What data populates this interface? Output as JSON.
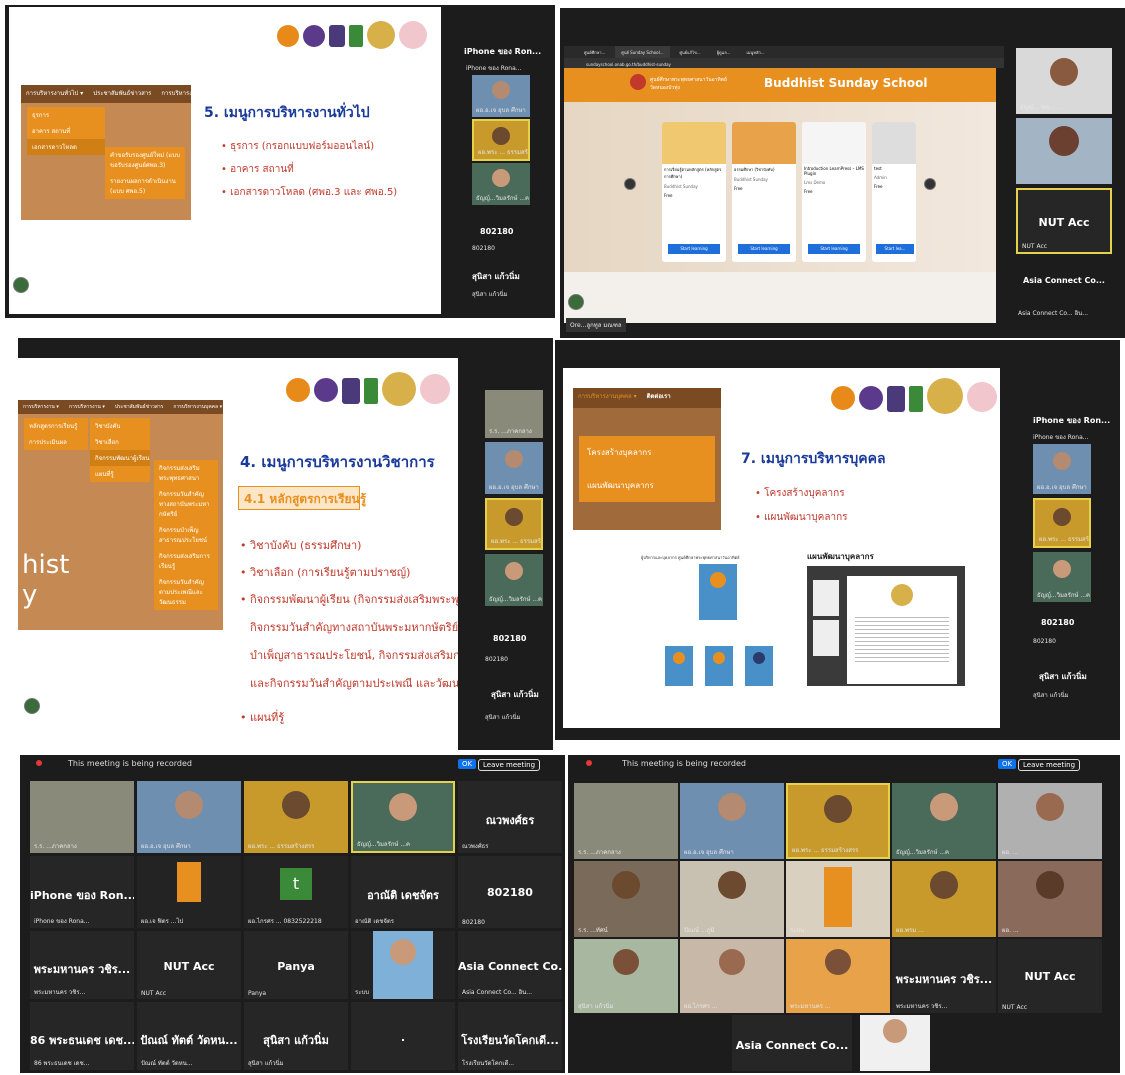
{
  "panel1": {
    "slide_title": "5. เมนูการบริหารงานทั่วไป",
    "bullets": [
      "ธุรการ (กรอกแบบฟอร์มออนไลน์)",
      "อาคาร สถานที่",
      "เอกสารดาวโหลด (ศพอ.3 และ ศพอ.5)"
    ],
    "menu_bar": [
      "การบริหารงานทั่วไป ▾",
      "ประชาสัมพันธ์ข่าวสาร",
      "การบริหารงานบุคคล ▾"
    ],
    "menu_items": [
      "ธุรการ",
      "อาคาร สถานที่",
      "เอกสารดาวโหลด"
    ],
    "submenu_items": [
      "คำขอรับรองศูนย์ใหม่ (แบบ ขอรับรองศูนย์ศพอ.3)",
      "รายงานผลการดำเนินงาน (แบบ ศพอ.5)"
    ],
    "sidebar_title": "iPhone ของ Ron...",
    "sidebar_sub": "iPhone ของ Rona...",
    "tiles": [
      "ผอ.อ.เจ อุบล ศึกษา",
      "ผอ.พระ ... ธรรมสร้างสรร",
      "ธัญญ์...วิมลรักษ์ ...ค"
    ],
    "bottom_names": [
      {
        "name": "802180",
        "sub": "802180"
      },
      {
        "name": "สุนิสา แก้วนิ่ม",
        "sub": "สุนิสา แก้วนิ่ม"
      }
    ]
  },
  "panel2": {
    "banner_title": "Buddhist Sunday School",
    "banner_org": "ศูนย์ศึกษาพระพุทธศาสนาวันอาทิตย์ วัดหนองบัวทุ่ง",
    "tabs": [
      "ศูนย์ศึกษา...",
      "ศูนย์ Sunday School...",
      "ศูนย์แก้ไข...",
      "ผู้ดูแล...",
      "เมนูหลัก..."
    ],
    "url": "sundayschool.onab.go.th/buddhist-sunday",
    "courses": [
      {
        "title": "การเรียนรู้ตามหลักสูตร (หลักสูตรการศึกษา)",
        "org": "Buddhist Sunday",
        "price": "Free",
        "button": "Start learning"
      },
      {
        "title": "ธรรมศึกษา (วิชาบังคับ)",
        "org": "Buddhist Sunday",
        "price": "Free",
        "button": "Start learning"
      },
      {
        "title": "Introduction LearnPress – LMS Plugin",
        "org": "Lms Demo",
        "price": "Free",
        "button": "Start learning"
      },
      {
        "title": "test",
        "org": "Admin",
        "price": "Free",
        "button": "Start lea..."
      }
    ],
    "sidebar_names": [
      "ธัญญ์... พลุ... ...",
      "NUT Acc",
      "Asia Connect Co..."
    ],
    "sidebar_subs": [
      "ธัญญ์... พลุ... ...",
      "NUT Acc",
      "Asia Connect Co... อิน..."
    ],
    "footer_label": "Ore...ลูกทูล มณฑล"
  },
  "panel3": {
    "slide_title": "4. เมนูการบริหารงานวิชาการ",
    "subtitle": "4.1 หลักสูตรการเรียนรู้",
    "bullets": [
      "วิชาบังคับ (ธรรมศึกษา)",
      "วิชาเลือก (การเรียนรู้ตามปราชญ์)",
      "กิจกรรมพัฒนาผู้เรียน (กิจกรรมส่งเสริมพระพุทธศาสนา,",
      "กิจกรรมวันสำคัญทางสถาบันพระมหากษัตริย์, กิจกรรม",
      "บำเพ็ญสาธารณประโยชน์, กิจกรรมส่งเสริมการเรียนรู้",
      "และกิจกรรมวันสำคัญตามประเพณี และวัฒนธรรม)",
      "แผนที่รู้"
    ],
    "menu_bar": [
      "การบริหารงาน ▾",
      "การบริหารงาน ▾",
      "ประชาสัมพันธ์ข่าวสาร",
      "การบริหารงานบุคคล ▾"
    ],
    "menu_col1": [
      "หลักสูตรการเรียนรู้",
      "การประเมินผล"
    ],
    "menu_col2": [
      "วิชาบังคับ",
      "วิชาเลือก",
      "กิจกรรมพัฒนาผู้เรียน",
      "แผนที่รู้"
    ],
    "menu_col3": [
      "กิจกรรมส่งเสริมพระพุทธศาสนา",
      "กิจกรรมวันสำคัญทางสถาบันพระมหากษัตริย์",
      "กิจกรรมบำเพ็ญสาธารณประโยชน์",
      "กิจกรรมส่งเสริมการเรียนรู้",
      "กิจกรรมวันสำคัญตามประเพณีและวัฒนธรรม"
    ],
    "bg_text": "hist\ny",
    "tiles": [
      "ร.ร. ...ภาคกลาง",
      "ผอ.อ.เจ อุบล ศึกษา",
      "ผอ.พระ ... ธรรมสร้างสรร",
      "ธัญญ์...วิมลรักษ์ ...ค"
    ],
    "bottom_names": [
      {
        "name": "802180",
        "sub": "802180"
      },
      {
        "name": "สุนิสา แก้วนิ่ม",
        "sub": "สุนิสา แก้วนิ่ม"
      }
    ]
  },
  "panel4": {
    "slide_title": "7. เมนูการบริหารบุคคล",
    "bullets": [
      "โครงสร้างบุคลากร",
      "แผนพัฒนาบุคลากร"
    ],
    "menu_bar": [
      "การบริหารงานบุคคล ▾",
      "ติดต่อเรา"
    ],
    "menu_items": [
      "โครงสร้างบุคลากร",
      "แผนพัฒนาบุคลากร"
    ],
    "section_label": "แผนพัฒนาบุคลากร",
    "org_caption": "ผู้บริหารและบุคลากร ศูนย์ศึกษาพระพุทธศาสนาวันอาทิตย์",
    "sidebar_title": "iPhone ของ Ron...",
    "sidebar_sub": "iPhone ของ Rona...",
    "tiles": [
      "ผอ.อ.เจ อุบล ศึกษา",
      "ผอ.พระ ... ธรรมสร้างสรร",
      "ธัญญ์...วิมลรักษ์ ...ค"
    ],
    "bottom_names": [
      {
        "name": "802180",
        "sub": "802180"
      },
      {
        "name": "สุนิสา แก้วนิ่ม",
        "sub": "สุนิสา แก้วนิ่ม"
      }
    ]
  },
  "panel5": {
    "recording_text": "This meeting is being recorded",
    "ok_label": "OK",
    "leave_label": "Leave meeting",
    "video_tiles": [
      "ร.ร. ...ภาคกลาง",
      "ผอ.อ.เจ อุบล ศึกษา",
      "ผอ.พระ ... ธรรมสร้างสรร",
      "ธัญญ์...วิมลรักษ์ ...ค"
    ],
    "name_tiles": [
      {
        "name": "ณวพงศ์ธร",
        "sub": "ณวพงศ์ธร"
      },
      {
        "name": "iPhone ของ Ron...",
        "sub": "iPhone ของ Rona..."
      },
      {
        "name": "",
        "sub": "ผอ.เจ ฟิตร ...ไป"
      },
      {
        "name": "t",
        "sub": "ผอ.ไกรศร ... 0832522218"
      },
      {
        "name": "อาณัติ เดชจัตร",
        "sub": "อาณัติ เดชจัตร"
      },
      {
        "name": "802180",
        "sub": "802180"
      },
      {
        "name": "พระมหานคร วชิร...",
        "sub": "พระมหานคร วชิร..."
      },
      {
        "name": "NUT Acc",
        "sub": "NUT Acc"
      },
      {
        "name": "Panya",
        "sub": "Panya"
      },
      {
        "name": "",
        "sub": "ระบบ"
      },
      {
        "name": "Asia Connect Co...",
        "sub": "Asia Connect Co... อิน..."
      },
      {
        "name": "86 พระธนเดช เดช...",
        "sub": "86 พระธนเดช เดช..."
      },
      {
        "name": "ปัณณ์ ทัตต์ วัดหน...",
        "sub": "ปัณณ์ ทัตต์ วัดหน..."
      },
      {
        "name": "สุนิสา แก้วนิ่ม",
        "sub": "สุนิสา แก้วนิ่ม"
      },
      {
        "name": ".",
        "sub": ""
      },
      {
        "name": "โรงเรียนวัดโคกเดี...",
        "sub": "โรงเรียนวัดโคกเดี..."
      }
    ]
  },
  "panel6": {
    "recording_text": "This meeting is being recorded",
    "ok_label": "OK",
    "leave_label": "Leave meeting",
    "tiles": [
      "ร.ร. ...ภาคกลาง",
      "ผอ.อ.เจ อุบล ศึกษา",
      "ผอ.พระ ... ธรรมสร้างสรร",
      "ธัญญ์...วิมลรักษ์ ...ค",
      "ผอ. ...",
      "ร.ร. ...ทัศน์",
      "ปัณณ์ ...ภูมิ",
      "ระบบ",
      "ผอ.พรม ...",
      "ผอ. ...",
      "สุนิสา แก้วนิ่ม",
      "ผอ.ไกรศร ...",
      "พระมหานคร ..."
    ],
    "name_tiles": [
      {
        "name": "พระมหานคร วชิร...",
        "sub": "พระมหานคร วชิร..."
      },
      {
        "name": "NUT Acc",
        "sub": "NUT Acc"
      },
      {
        "name": "Asia Connect Co...",
        "sub": ""
      }
    ]
  },
  "colors": {
    "orange": "#e8901f",
    "zoom_bg": "#1c1c1c",
    "title_blue": "#1a3a9a",
    "bullet_red": "#c0392b",
    "active_border": "#e6d24a"
  }
}
